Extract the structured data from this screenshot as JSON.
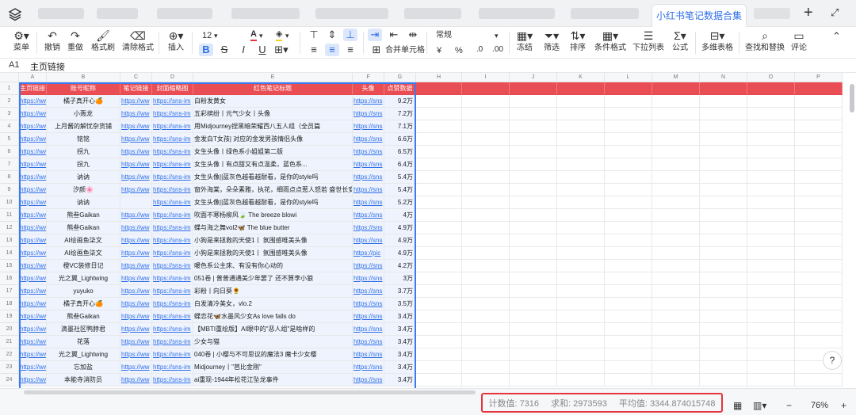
{
  "tabbar": {
    "active_tab": "小红书笔记数据合集",
    "plus_icon": "plus-icon",
    "expand_icon": "expand-icon"
  },
  "ribbon": {
    "menu": "菜单",
    "undo": "撤销",
    "redo": "重做",
    "format_painter": "格式刷",
    "clear_format": "清除格式",
    "insert": "插入",
    "font_size": "12",
    "font_color_letter": "A",
    "merge_cells": "合并单元格",
    "number_format": "常规",
    "currency": "¥",
    "percent": "%",
    "freeze": "冻结",
    "filter": "筛选",
    "sort": "排序",
    "conditional_format": "条件格式",
    "dropdown_list": "下拉列表",
    "formula": "公式",
    "multidim_table": "多维表格",
    "find_replace": "查找和替换",
    "comment": "评论"
  },
  "formula_bar": {
    "cell_ref": "A1",
    "value": "主页链接"
  },
  "grid": {
    "columns": [
      "A",
      "B",
      "C",
      "D",
      "E",
      "F",
      "G",
      "H",
      "I",
      "J",
      "K",
      "L",
      "M",
      "N",
      "O",
      "P"
    ],
    "headers": [
      "主页链接",
      "账号昵称",
      "笔记链接",
      "封面缩略图",
      "红色笔记标题",
      "头像",
      "点赞数据"
    ],
    "rows": [
      {
        "n": "2",
        "a": "https://ww",
        "b": "橘子真开心🍊",
        "c": "https://ww",
        "d": "https://sns-im",
        "e": "白粉发黄女",
        "f": "https://sns",
        "g": "9.2万"
      },
      {
        "n": "3",
        "a": "https://ww",
        "b": "小轰龙",
        "c": "https://ww",
        "d": "https://sns-im",
        "e": "五彩缤纷丨元气少女丨头像",
        "f": "https://sns",
        "g": "7.2万"
      },
      {
        "n": "4",
        "a": "https://ww",
        "b": "上月酱的解忧杂货铺",
        "c": "https://ww",
        "d": "https://sns-im",
        "e": "用Midjourney捏黑暗荣耀西八五人组（全员篇",
        "f": "https://sns",
        "g": "7.1万"
      },
      {
        "n": "5",
        "a": "https://ww",
        "b": "铭铭",
        "c": "https://ww",
        "d": "https://sns-im",
        "e": "金发白T女孩| 对应的金发男孩情侣头像",
        "f": "https://sns",
        "g": "6.6万"
      },
      {
        "n": "6",
        "a": "https://ww",
        "b": "拐九",
        "c": "https://ww",
        "d": "https://sns-im",
        "e": "女生头像丨绿色系小姐姐第二版",
        "f": "https://sns",
        "g": "6.5万"
      },
      {
        "n": "7",
        "a": "https://ww",
        "b": "拐九",
        "c": "https://ww",
        "d": "https://sns-im",
        "e": "女生头像丨有点甜又有点温柔，蓝色系...",
        "f": "https://sns",
        "g": "6.4万"
      },
      {
        "n": "8",
        "a": "https://ww",
        "b": "讷讷",
        "c": "https://ww",
        "d": "https://sns-im",
        "e": "女生头像||蓝灰色越看越耐看，是你的style吗",
        "f": "https://sns",
        "g": "5.4万"
      },
      {
        "n": "9",
        "a": "https://ww",
        "b": "汐颜🌸",
        "c": "https://ww",
        "d": "https://sns-im",
        "e": "窗外海棠，朵朵素雅，执花，细雨点点惹人怒若 盛世长安",
        "f": "https://sns",
        "g": "5.4万"
      },
      {
        "n": "10",
        "a": "https://ww",
        "b": "讷讷",
        "c": "",
        "d": "https://sns-im",
        "e": "女生头像||蓝灰色越看越耐看，是你的style吗",
        "f": "https://sns",
        "g": "5.2万"
      },
      {
        "n": "11",
        "a": "https://ww",
        "b": "熊叁Gaikan",
        "c": "https://ww",
        "d": "https://sns-im",
        "e": "吹面不寒杨柳风🍃 The breeze blowi",
        "f": "https://sns",
        "g": "4万"
      },
      {
        "n": "12",
        "a": "https://ww",
        "b": "熊叁Gaikan",
        "c": "https://ww",
        "d": "https://sns-im",
        "e": "蝶与海之舞vol2🦋 The blue butter",
        "f": "https://sns",
        "g": "4.9万"
      },
      {
        "n": "13",
        "a": "https://ww",
        "b": "AI绘画鱼柒文",
        "c": "https://ww",
        "d": "https://sns-im",
        "e": "小狗是来拯救的天使1丨 氛围感唯美头像",
        "f": "https://sns",
        "g": "4.9万"
      },
      {
        "n": "14",
        "a": "https://ww",
        "b": "AI绘画鱼柒文",
        "c": "https://ww",
        "d": "https://sns-im",
        "e": "小狗是来拯救的天使1丨 氛围感唯美头像",
        "f": "https://pic",
        "g": "4.9万"
      },
      {
        "n": "15",
        "a": "https://ww",
        "b": "橙VC装修日记",
        "c": "https://ww",
        "d": "https://sns-im",
        "e": "暖色系公主床、有没有你心动的",
        "f": "https://sns",
        "g": "4.2万"
      },
      {
        "n": "16",
        "a": "https://ww",
        "b": "光之翼_Lightwing",
        "c": "https://ww",
        "d": "https://sns-im",
        "e": "051卷 | 普普通通美少年罢了 还不算李小狼",
        "f": "https://sns",
        "g": "3万"
      },
      {
        "n": "17",
        "a": "https://ww",
        "b": "yuyuko",
        "c": "https://ww",
        "d": "https://sns-im",
        "e": "彩粉丨向日葵🌻",
        "f": "https://sns",
        "g": "3.7万"
      },
      {
        "n": "18",
        "a": "https://ww",
        "b": "橘子真开心🍊",
        "c": "https://ww",
        "d": "https://sns-im",
        "e": "白发清冷美女，vlo.2",
        "f": "https://sns",
        "g": "3.5万"
      },
      {
        "n": "19",
        "a": "https://ww",
        "b": "熊叁Gaikan",
        "c": "https://ww",
        "d": "https://sns-im",
        "e": "蝶恋花🦋水墨风少女As love falls do",
        "f": "https://sns",
        "g": "3.4万"
      },
      {
        "n": "20",
        "a": "https://ww",
        "b": "滴墨社区鸭脖君",
        "c": "https://ww",
        "d": "https://sns-im",
        "e": "【MBTI重绘版】AI眼中的\"恶人组\"是啥样的",
        "f": "https://sns",
        "g": "3.4万"
      },
      {
        "n": "21",
        "a": "https://ww",
        "b": "花落",
        "c": "https://ww",
        "d": "https://sns-im",
        "e": "少女与猫",
        "f": "https://sns",
        "g": "3.4万"
      },
      {
        "n": "22",
        "a": "https://ww",
        "b": "光之翼_Lightwing",
        "c": "https://ww",
        "d": "https://sns-im",
        "e": "040卷 | 小樱与不可思议的魔法3 魔卡少女樱",
        "f": "https://sns",
        "g": "3.4万"
      },
      {
        "n": "23",
        "a": "https://ww",
        "b": "忘加盐",
        "c": "https://ww",
        "d": "https://sns-im",
        "e": "Midjourney丨\"芭比金刚\"",
        "f": "https://sns",
        "g": "3.4万"
      },
      {
        "n": "24",
        "a": "https://ww",
        "b": "本能寺消防员",
        "c": "https://ww",
        "d": "https://sns-im",
        "e": "ai重现-1944年松花江坠龙事件",
        "f": "https://sns",
        "g": "3.4万"
      }
    ]
  },
  "statusbar": {
    "count": "计数值: 7316",
    "sum": "求和: 2973593",
    "average": "平均值: 3344.874015748",
    "zoom": "76%"
  },
  "colors": {
    "header_bg": "#ea4e55",
    "selection": "#3c7af0",
    "highlight_box": "#e5343c",
    "link": "#2f6fea"
  }
}
